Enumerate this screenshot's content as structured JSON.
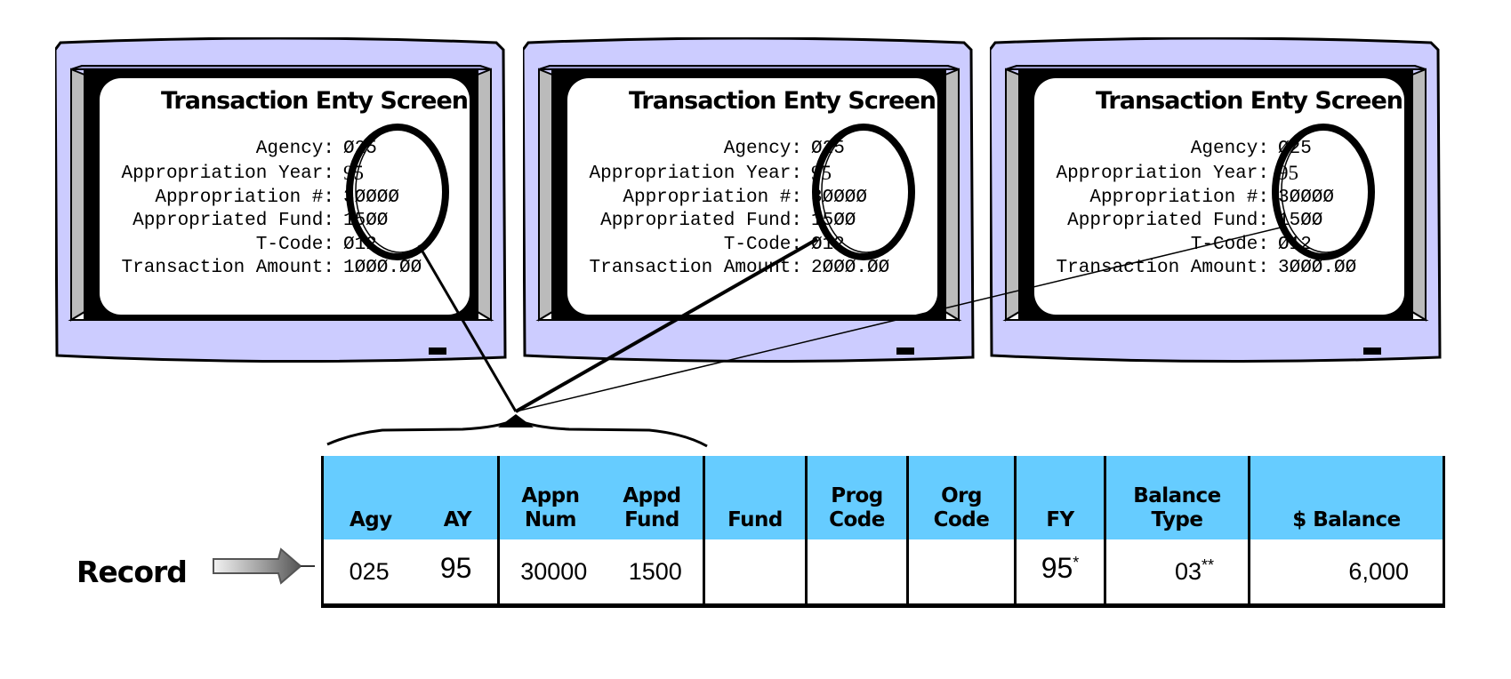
{
  "diagram": {
    "colors": {
      "casing": "#ccccff",
      "bevel_top": "#9999cc",
      "bevel_side": "#bbbbbb",
      "header": "#66ccff",
      "ink": "#000000",
      "screen": "#ffffff"
    },
    "monitors": [
      {
        "title": "Transaction Enty Screen",
        "fields": [
          {
            "label": "Agency:",
            "value": "Ø25"
          },
          {
            "label": "Appropriation Year:",
            "value": "95"
          },
          {
            "label": "Appropriation #:",
            "value": "3ØØØØ"
          },
          {
            "label": "Appropriated Fund:",
            "value": "15ØØ"
          },
          {
            "label": "T-Code:",
            "value": "Ø12"
          },
          {
            "label": "Transaction Amount:",
            "value": "1ØØØ.ØØ"
          }
        ]
      },
      {
        "title": "Transaction Enty Screen",
        "fields": [
          {
            "label": "Agency:",
            "value": "Ø25"
          },
          {
            "label": "Appropriation Year:",
            "value": "95"
          },
          {
            "label": "Appropriation #:",
            "value": "3ØØØØ"
          },
          {
            "label": "Appropriated Fund:",
            "value": "15ØØ"
          },
          {
            "label": "T-Code:",
            "value": "Ø12"
          },
          {
            "label": "Transaction Amount:",
            "value": "2ØØØ.ØØ"
          }
        ]
      },
      {
        "title": "Transaction Enty Screen",
        "fields": [
          {
            "label": "Agency:",
            "value": "Ø25"
          },
          {
            "label": "Appropriation Year:",
            "value": "95"
          },
          {
            "label": "Appropriation #:",
            "value": "3ØØØØ"
          },
          {
            "label": "Appropriated Fund:",
            "value": "15ØØ"
          },
          {
            "label": "T-Code:",
            "value": "Ø12"
          },
          {
            "label": "Transaction Amount:",
            "value": "3ØØØ.ØØ"
          }
        ]
      }
    ],
    "record": {
      "label": "Record",
      "icon": "arrow-right-icon",
      "headers": {
        "agy": "Agy",
        "ay": "AY",
        "appn_num": [
          "Appn",
          "Num"
        ],
        "appd_fund": [
          "Appd",
          "Fund"
        ],
        "fund": "Fund",
        "prog_code": [
          "Prog",
          "Code"
        ],
        "org_code": [
          "Org",
          "Code"
        ],
        "fy": "FY",
        "balance_type": [
          "Balance",
          "Type"
        ],
        "balance": "$ Balance"
      },
      "values": {
        "agy": "025",
        "ay": "95",
        "appn_num": "30000",
        "appd_fund": "1500",
        "fund": "",
        "prog_code": "",
        "org_code": "",
        "fy": "95",
        "fy_mark": "*",
        "balance_type": "03",
        "balance_type_mark": "**",
        "balance": "6,000"
      }
    }
  }
}
